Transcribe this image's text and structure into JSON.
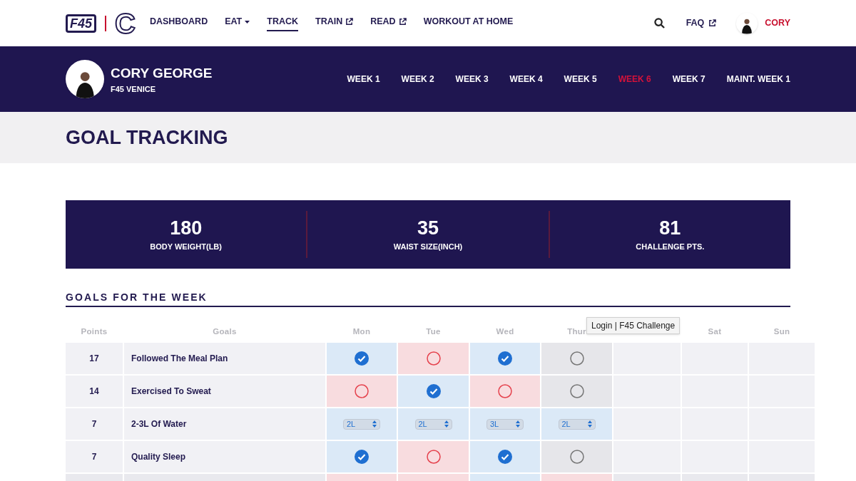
{
  "logo": {
    "brand": "F45",
    "mark": "C"
  },
  "nav": [
    {
      "label": "DASHBOARD",
      "selected": false,
      "kind": "link"
    },
    {
      "label": "EAT",
      "selected": false,
      "kind": "dropdown"
    },
    {
      "label": "TRACK",
      "selected": true,
      "kind": "link"
    },
    {
      "label": "TRAIN",
      "selected": false,
      "kind": "external"
    },
    {
      "label": "READ",
      "selected": false,
      "kind": "external"
    },
    {
      "label": "WORKOUT AT HOME",
      "selected": false,
      "kind": "link"
    }
  ],
  "top_right": {
    "faq": "FAQ",
    "user": "CORY"
  },
  "profile": {
    "name": "CORY GEORGE",
    "studio": "F45 VENICE"
  },
  "weeks": [
    {
      "label": "WEEK 1",
      "selected": false
    },
    {
      "label": "WEEK 2",
      "selected": false
    },
    {
      "label": "WEEK 3",
      "selected": false
    },
    {
      "label": "WEEK 4",
      "selected": false
    },
    {
      "label": "WEEK 5",
      "selected": false
    },
    {
      "label": "WEEK 6",
      "selected": true
    },
    {
      "label": "WEEK 7",
      "selected": false
    },
    {
      "label": "MAINT. WEEK 1",
      "selected": false
    }
  ],
  "page_title": "GOAL TRACKING",
  "stats": [
    {
      "value": "180",
      "label": "BODY WEIGHT(LB)"
    },
    {
      "value": "35",
      "label": "WAIST SIZE(INCH)"
    },
    {
      "value": "81",
      "label": "CHALLENGE PTS."
    }
  ],
  "goals": {
    "title": "GOALS FOR THE WEEK",
    "columns": [
      {
        "kind": "label",
        "label": "Points"
      },
      {
        "kind": "label",
        "label": "Goals"
      },
      {
        "kind": "label",
        "label": "Mon"
      },
      {
        "kind": "label",
        "label": "Tue"
      },
      {
        "kind": "label",
        "label": "Wed"
      },
      {
        "kind": "label",
        "label": "Thur"
      },
      {
        "kind": "covered"
      },
      {
        "kind": "label",
        "label": "Sat"
      },
      {
        "kind": "label",
        "label": "Sun"
      }
    ],
    "rows": [
      {
        "points": "17",
        "goal": "Followed The Meal Plan",
        "days": [
          {
            "kind": "check",
            "checked": true
          },
          {
            "kind": "check",
            "checked": false,
            "past": true
          },
          {
            "kind": "check",
            "checked": true
          },
          {
            "kind": "check",
            "checked": false,
            "past": false
          },
          {
            "kind": "empty"
          },
          {
            "kind": "empty"
          },
          {
            "kind": "empty"
          }
        ]
      },
      {
        "points": "14",
        "goal": "Exercised To Sweat",
        "days": [
          {
            "kind": "check",
            "checked": false,
            "past": true
          },
          {
            "kind": "check",
            "checked": true
          },
          {
            "kind": "check",
            "checked": false,
            "past": true
          },
          {
            "kind": "check",
            "checked": false,
            "past": false
          },
          {
            "kind": "empty"
          },
          {
            "kind": "empty"
          },
          {
            "kind": "empty"
          }
        ]
      },
      {
        "points": "7",
        "goal": "2-3L Of Water",
        "days": [
          {
            "kind": "select",
            "value": "2L"
          },
          {
            "kind": "select",
            "value": "2L"
          },
          {
            "kind": "select",
            "value": "3L"
          },
          {
            "kind": "select",
            "value": "2L"
          },
          {
            "kind": "empty"
          },
          {
            "kind": "empty"
          },
          {
            "kind": "empty"
          }
        ]
      },
      {
        "points": "7",
        "goal": "Quality Sleep",
        "days": [
          {
            "kind": "check",
            "checked": true
          },
          {
            "kind": "check",
            "checked": false,
            "past": true
          },
          {
            "kind": "check",
            "checked": true
          },
          {
            "kind": "check",
            "checked": false,
            "past": false
          },
          {
            "kind": "empty"
          },
          {
            "kind": "empty"
          },
          {
            "kind": "empty"
          }
        ]
      },
      {
        "days": [
          {
            "kind": "tint",
            "checked": false,
            "past": true
          },
          {
            "kind": "tint",
            "checked": false,
            "past": true
          },
          {
            "kind": "tint",
            "checked": true
          },
          {
            "kind": "tint",
            "checked": false,
            "past": true
          },
          {
            "kind": "empty"
          },
          {
            "kind": "empty"
          },
          {
            "kind": "empty"
          }
        ]
      }
    ]
  },
  "tooltip": "Login | F45 Challenge"
}
